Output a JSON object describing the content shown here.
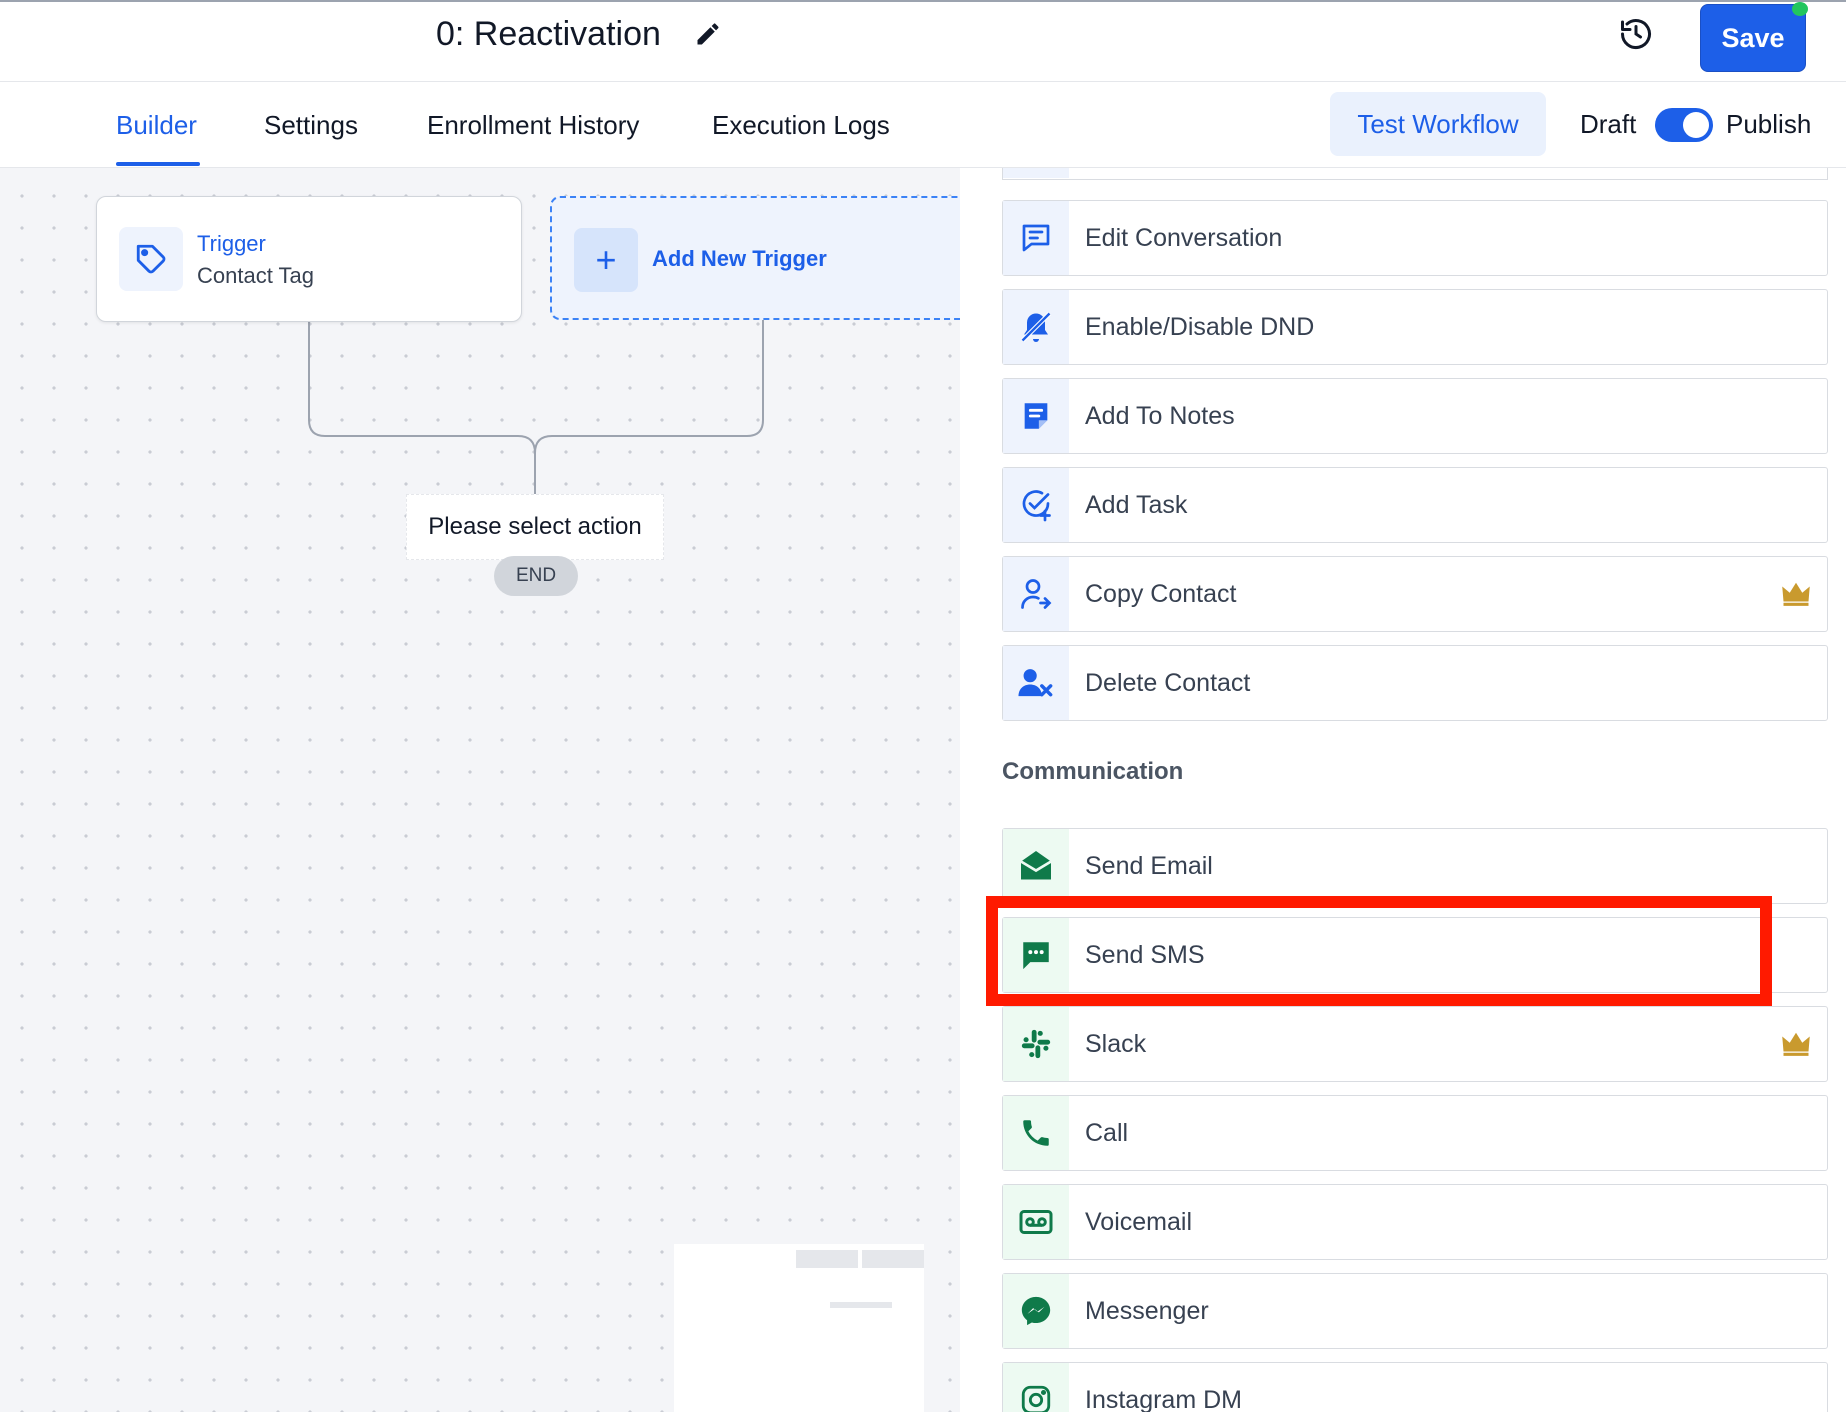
{
  "header": {
    "workflow_title": "0: Reactivation",
    "save_label": "Save"
  },
  "tabs": [
    {
      "label": "Builder",
      "active": true
    },
    {
      "label": "Settings",
      "active": false
    },
    {
      "label": "Enrollment History",
      "active": false
    },
    {
      "label": "Execution Logs",
      "active": false
    }
  ],
  "toolbar": {
    "test_label": "Test Workflow",
    "draft_label": "Draft",
    "publish_label": "Publish",
    "publish_toggle_on": true
  },
  "canvas": {
    "trigger_title": "Trigger",
    "trigger_subtitle": "Contact Tag",
    "add_trigger_label": "Add New Trigger",
    "select_action_label": "Please select action",
    "end_label": "END"
  },
  "panel": {
    "contact_actions": [
      {
        "label": "Edit Conversation",
        "icon": "chat-edit-icon",
        "premium": false
      },
      {
        "label": "Enable/Disable DND",
        "icon": "bell-off-icon",
        "premium": false
      },
      {
        "label": "Add To Notes",
        "icon": "notes-icon",
        "premium": false
      },
      {
        "label": "Add Task",
        "icon": "task-check-icon",
        "premium": false
      },
      {
        "label": "Copy Contact",
        "icon": "user-copy-icon",
        "premium": true
      },
      {
        "label": "Delete Contact",
        "icon": "user-delete-icon",
        "premium": false
      }
    ],
    "communication_section": "Communication",
    "communication_actions": [
      {
        "label": "Send Email",
        "icon": "envelope-icon",
        "premium": false
      },
      {
        "label": "Send SMS",
        "icon": "sms-icon",
        "premium": false
      },
      {
        "label": "Slack",
        "icon": "slack-icon",
        "premium": true
      },
      {
        "label": "Call",
        "icon": "phone-icon",
        "premium": false
      },
      {
        "label": "Voicemail",
        "icon": "voicemail-icon",
        "premium": false
      },
      {
        "label": "Messenger",
        "icon": "messenger-icon",
        "premium": false
      },
      {
        "label": "Instagram DM",
        "icon": "instagram-icon",
        "premium": false
      }
    ]
  },
  "colors": {
    "primary": "#1d5fe8",
    "contact_icon": "#1d5fe8",
    "communication_icon": "#0f7a4a",
    "premium_crown": "#c99a2e",
    "highlight": "#ff1a00"
  }
}
